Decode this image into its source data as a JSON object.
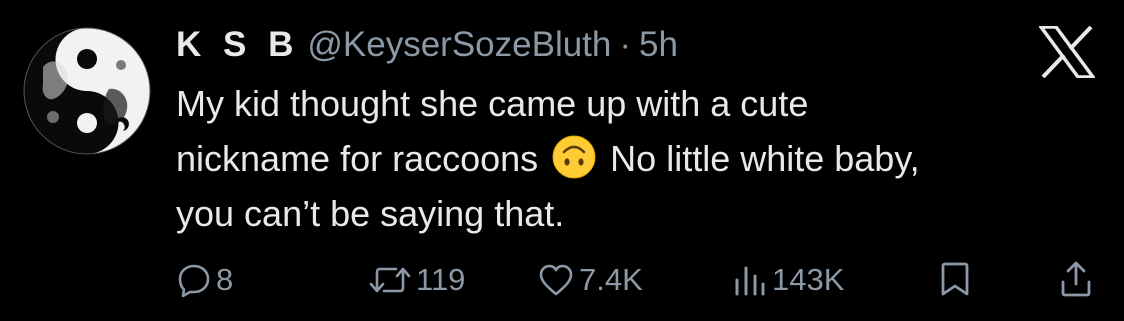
{
  "tweet": {
    "display_name": "K S B",
    "handle": "@KeyserSozeBluth",
    "separator": "·",
    "timestamp": "5h",
    "text_part1": "My kid thought she came up with a cute\nnickname for raccoons ",
    "emoji": "upside-down-face",
    "text_part2": " No little white baby,\nyou can’t be saying that."
  },
  "actions": {
    "replies": "8",
    "reposts": "119",
    "likes": "7.4K",
    "views": "143K"
  },
  "icons": {
    "platform_logo": "x-logo",
    "reply": "speech-bubble-icon",
    "repost": "repost-arrows-icon",
    "like": "heart-icon",
    "views": "bar-chart-icon",
    "bookmark": "bookmark-icon",
    "share": "share-upload-icon"
  },
  "colors": {
    "background": "#000000",
    "primary_text": "#e7e9ea",
    "secondary_text": "#8b98a5",
    "emoji_yellow": "#ffcc33"
  }
}
